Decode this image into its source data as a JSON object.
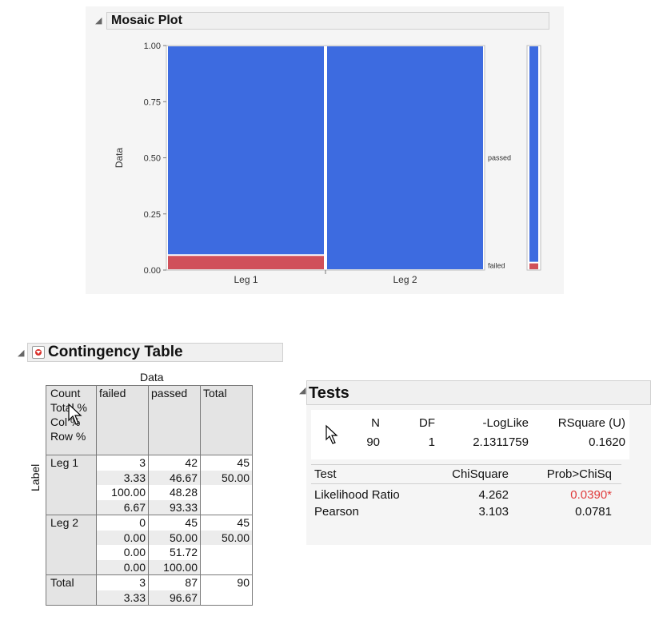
{
  "mosaic": {
    "title": "Mosaic Plot",
    "y_axis_label": "Data",
    "right_labels": [
      "passed",
      "failed"
    ]
  },
  "chart_data": {
    "type": "mosaic",
    "ylabel": "Data",
    "ylim": [
      0,
      1
    ],
    "yticks": [
      "0.00",
      "0.25",
      "0.50",
      "0.75",
      "1.00"
    ],
    "categories": [
      "Leg 1",
      "Leg 2"
    ],
    "widths": [
      0.5,
      0.5
    ],
    "series": [
      {
        "name": "failed",
        "values": [
          0.0667,
          0.0
        ],
        "color": "#d0505a"
      },
      {
        "name": "passed",
        "values": [
          0.9333,
          1.0
        ],
        "color": "#3d6be0"
      }
    ],
    "marginal": {
      "failed": 0.0333,
      "passed": 0.9667
    }
  },
  "contingency": {
    "title": "Contingency Table",
    "col_group_label": "Data",
    "row_group_label": "Label",
    "key": [
      "Count",
      "Total %",
      "Col %",
      "Row %"
    ],
    "columns": [
      "failed",
      "passed",
      "Total"
    ],
    "rows": [
      {
        "label": "Leg 1",
        "failed": [
          "3",
          "3.33",
          "100.00",
          "6.67"
        ],
        "passed": [
          "42",
          "46.67",
          "48.28",
          "93.33"
        ],
        "total": [
          "45",
          "50.00"
        ]
      },
      {
        "label": "Leg 2",
        "failed": [
          "0",
          "0.00",
          "0.00",
          "0.00"
        ],
        "passed": [
          "45",
          "50.00",
          "51.72",
          "100.00"
        ],
        "total": [
          "45",
          "50.00"
        ]
      },
      {
        "label": "Total",
        "failed": [
          "3",
          "3.33"
        ],
        "passed": [
          "87",
          "96.67"
        ],
        "total": [
          "90"
        ]
      }
    ]
  },
  "tests": {
    "title": "Tests",
    "summary_headers": [
      "N",
      "DF",
      "-LogLike",
      "RSquare (U)"
    ],
    "summary_values": [
      "90",
      "1",
      "2.1311759",
      "0.1620"
    ],
    "test_headers": [
      "Test",
      "ChiSquare",
      "Prob>ChiSq"
    ],
    "test_rows": [
      {
        "test": "Likelihood Ratio",
        "chisq": "4.262",
        "prob": "0.0390*",
        "significant": true
      },
      {
        "test": "Pearson",
        "chisq": "3.103",
        "prob": "0.0781",
        "significant": false
      }
    ],
    "significant_color": "#e03c3c"
  }
}
